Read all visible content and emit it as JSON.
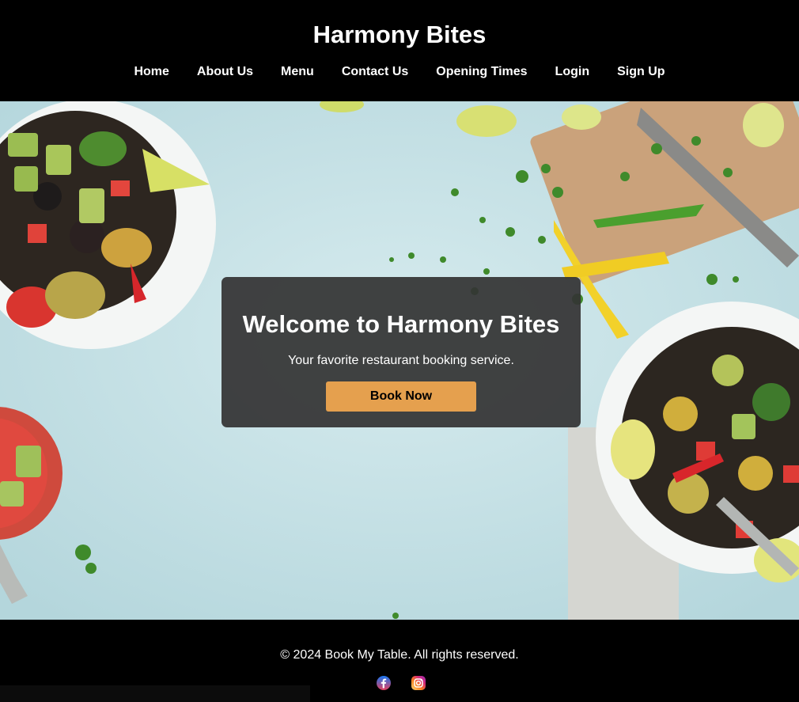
{
  "header": {
    "brand": "Harmony Bites",
    "nav": [
      "Home",
      "About Us",
      "Menu",
      "Contact Us",
      "Opening Times",
      "Login",
      "Sign Up"
    ]
  },
  "hero": {
    "title": "Welcome to Harmony Bites",
    "subtitle": "Your favorite restaurant booking service.",
    "cta": "Book Now"
  },
  "footer": {
    "copyright": "© 2024 Book My Table. All rights reserved.",
    "social_icons": [
      "facebook-icon",
      "instagram-icon"
    ]
  },
  "colors": {
    "header_bg": "#000000",
    "cta_bg": "#e5a04e",
    "card_bg": "#343434",
    "hero_bg": "#c7e1e5"
  }
}
